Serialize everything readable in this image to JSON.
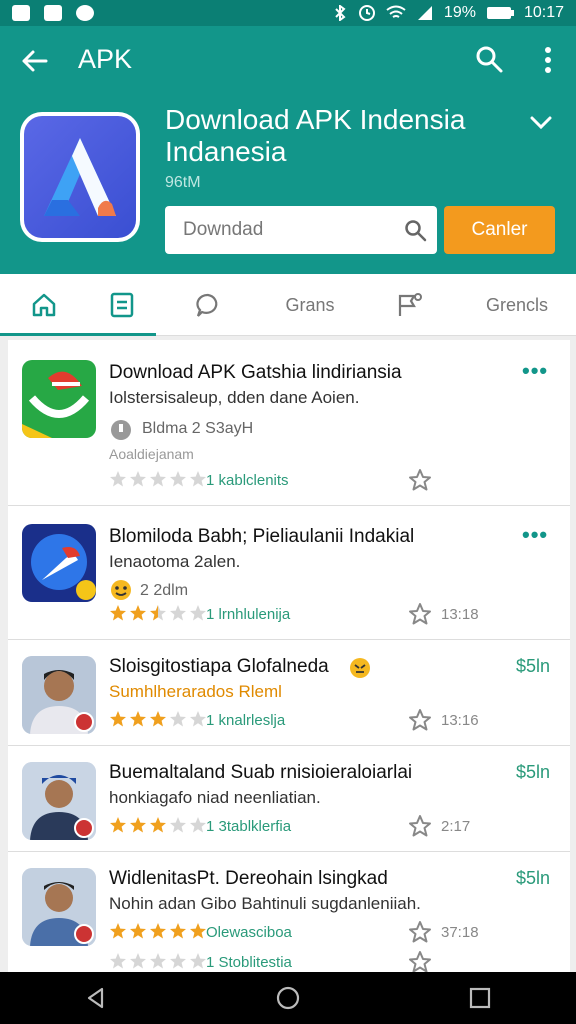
{
  "statusbar": {
    "battery_pct": "19%",
    "time": "10:17"
  },
  "topbar": {
    "title": "APK"
  },
  "app": {
    "title": "Download APK Indensia Indanesia",
    "subtitle": "96tM",
    "search_placeholder": "Downdad",
    "cta_label": "Canler"
  },
  "tabs": [
    {
      "label": "",
      "icon": "home-icon",
      "active": true
    },
    {
      "label": "",
      "icon": "list-icon",
      "active": false
    },
    {
      "label": "",
      "icon": "chat-icon",
      "active": false
    },
    {
      "label": "Grans",
      "icon": "",
      "active": false
    },
    {
      "label": "",
      "icon": "flag-icon",
      "active": false
    },
    {
      "label": "Grencls",
      "icon": "",
      "active": false
    }
  ],
  "rows": [
    {
      "title": "Download APK Gatshia lindiriansia",
      "desc": "Iolstersisaleup, dden dane Aoien.",
      "meta": "Bldma 2 S3ayH",
      "meta2": "Aoaldiejanam",
      "rating": 0,
      "count": "1 kablclenits",
      "time": "",
      "action": "dots"
    },
    {
      "title": "Blomiloda Babh; Pieliaulanii Indakial",
      "desc": "Ienaotoma 2alen.",
      "meta": "2 2dlm",
      "meta2": "",
      "rating": 2.5,
      "count": "1 lrnhlulenija",
      "time": "13:18",
      "action": "dots"
    },
    {
      "title": "Sloisgitostiapa Glofalneda",
      "desc": "Sumhlherarados Rleml",
      "meta": "",
      "meta2": "",
      "rating": 3,
      "count": "1 knalrleslja",
      "time": "13:16",
      "action": "$5ln"
    },
    {
      "title": "Buemaltaland Suab rnisioieraloiarlai",
      "desc": "honkiagafo niad neenliatian.",
      "meta": "",
      "meta2": "",
      "rating": 3,
      "count": "1 3tablklerfia",
      "time": "2:17",
      "action": "$5ln"
    },
    {
      "title": "WidlenitasPt. Dereohain lsingkad",
      "desc": "Nohin adan Gibo Bahtinuli sugdanleniiah.",
      "meta": "",
      "meta2": "",
      "rating": 5,
      "count": "Olewasciboa",
      "time": "37:18",
      "action": "$5ln"
    },
    {
      "title": "",
      "desc": "",
      "meta": "",
      "meta2": "",
      "rating": 0,
      "count": "1 Stoblitestia",
      "time": "",
      "action": ""
    }
  ],
  "colors": {
    "header": "#12968a",
    "statusbar": "#0b7f74",
    "accent": "#f39a1e",
    "star": "#f0a01e"
  }
}
